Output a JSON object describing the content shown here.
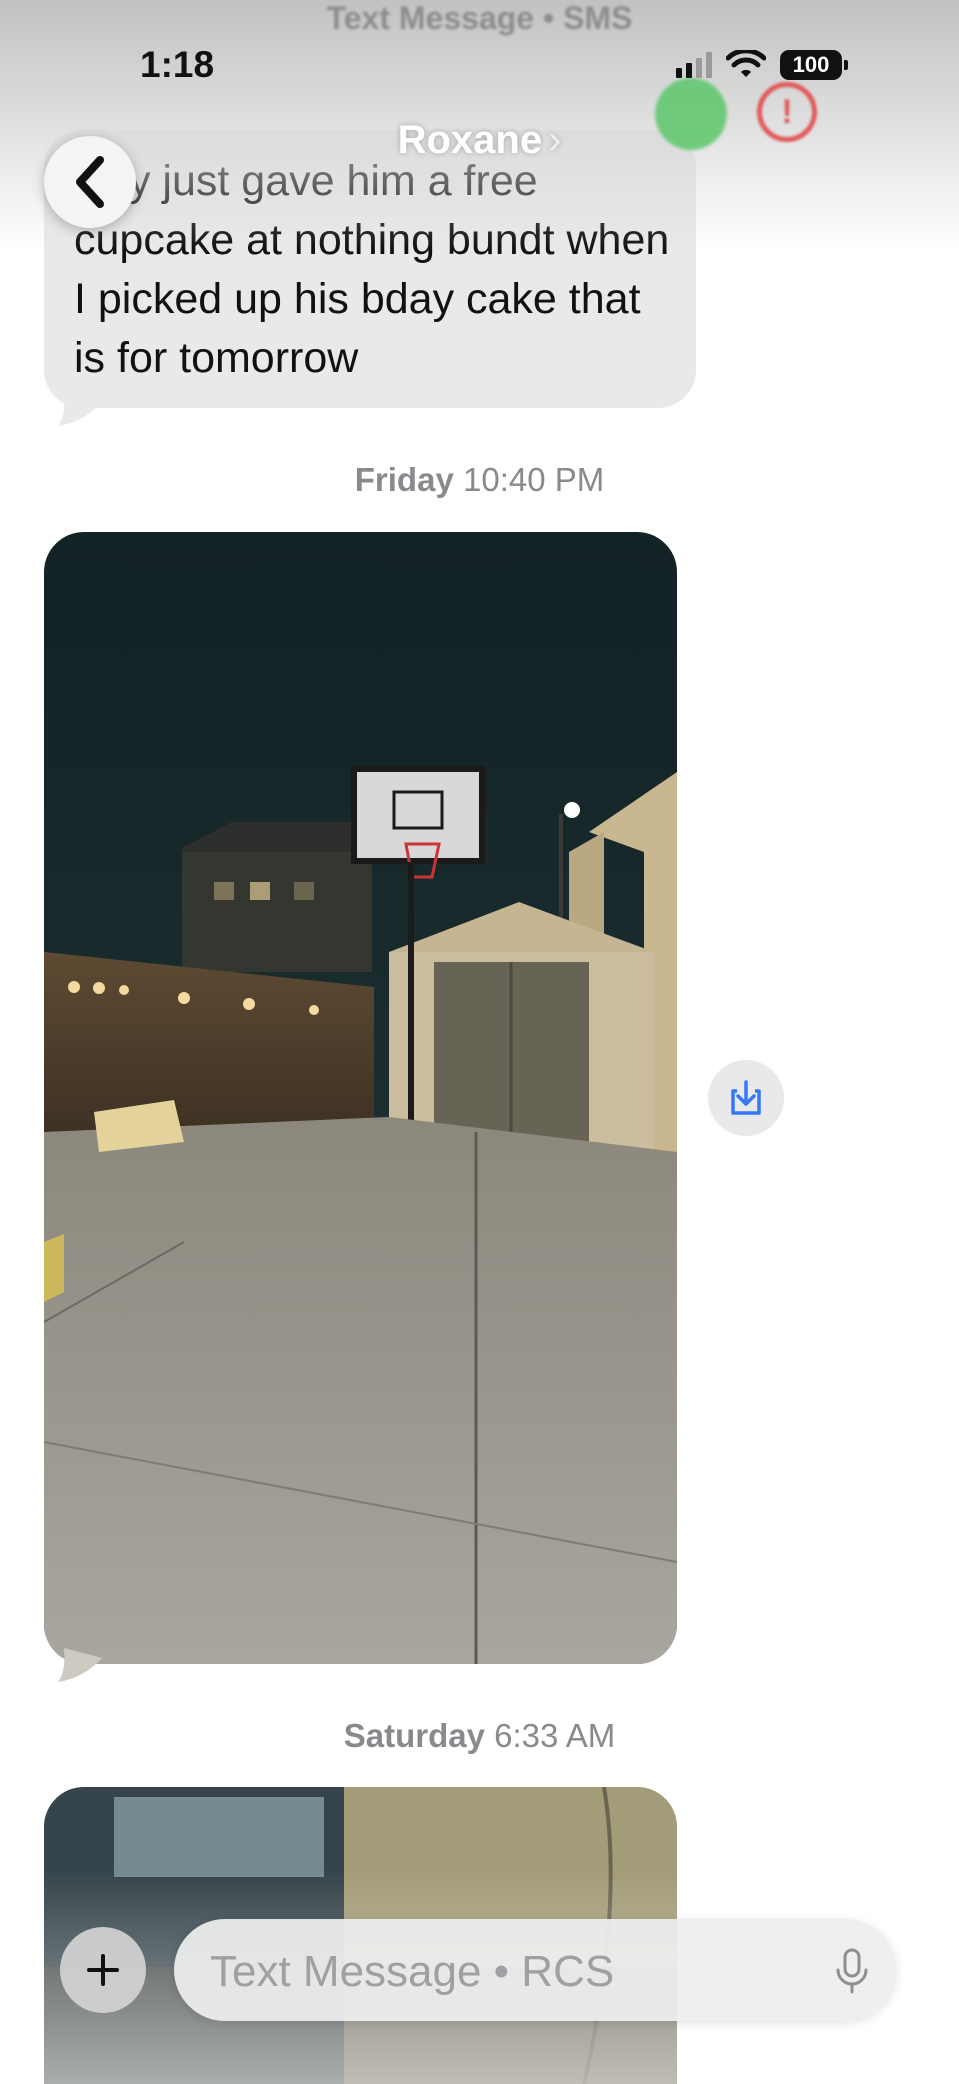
{
  "header": {
    "service_label": "Text Message • SMS",
    "contact_name": "Roxane",
    "name_chevron": "›"
  },
  "status_bar": {
    "time": "1:18",
    "battery": "100"
  },
  "messages": {
    "first_bubble_text": "Hey just gave him a free cupcake at nothing bundt when I picked up his bday cake that is for tomorrow",
    "timestamp_1_day": "Friday",
    "timestamp_1_time": "10:40 PM",
    "timestamp_2_day": "Saturday",
    "timestamp_2_time": "6:33 AM"
  },
  "composer": {
    "placeholder": "Text Message • RCS"
  },
  "icons": {
    "back": "chevron-left-icon",
    "save": "save-download-icon",
    "add": "plus-icon",
    "mic": "microphone-icon",
    "wifi": "wifi-icon",
    "alert": "exclamation-icon"
  },
  "colors": {
    "bubble_gray": "#e9e9eb",
    "timestamp_gray": "#8a8a8e",
    "accent_blue": "#3478f6",
    "alert_red": "#e25a5a",
    "blob_green": "#5cc76b"
  }
}
